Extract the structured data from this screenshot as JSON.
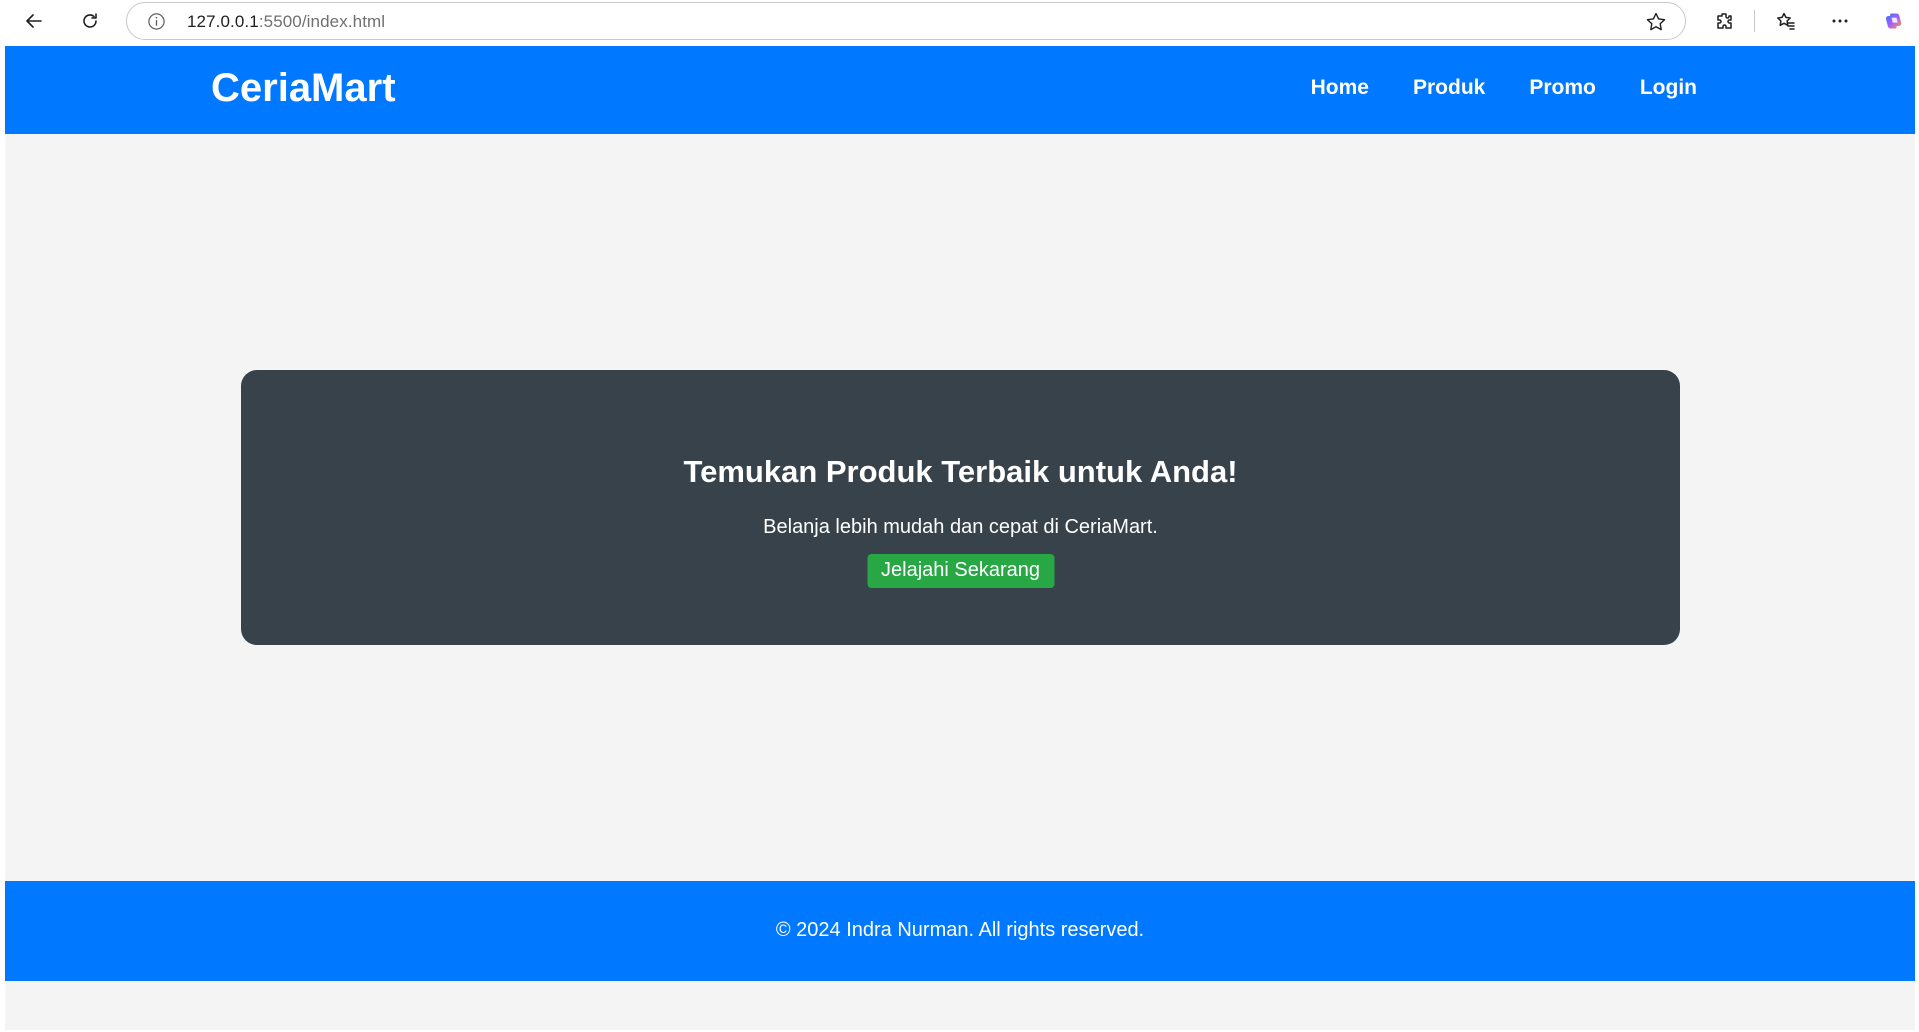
{
  "browser": {
    "url_host": "127.0.0.1",
    "url_path": ":5500/index.html",
    "icons": [
      "back-arrow-icon",
      "refresh-icon",
      "site-info-icon",
      "star-icon",
      "extensions-icon",
      "favorites-icon",
      "more-icon",
      "copilot-icon"
    ]
  },
  "header": {
    "logo": "CeriaMart",
    "nav": [
      {
        "label": "Home"
      },
      {
        "label": "Produk"
      },
      {
        "label": "Promo"
      },
      {
        "label": "Login"
      }
    ]
  },
  "hero": {
    "title": "Temukan Produk Terbaik untuk Anda!",
    "subtitle": "Belanja lebih mudah dan cepat di CeriaMart.",
    "cta_label": "Jelajahi Sekarang"
  },
  "footer": {
    "text": "© 2024 Indra Nurman. All rights reserved."
  },
  "colors": {
    "primary": "#0078ff",
    "hero_bg": "#37424b",
    "cta_bg": "#28a745",
    "page_bg": "#f4f4f4"
  }
}
